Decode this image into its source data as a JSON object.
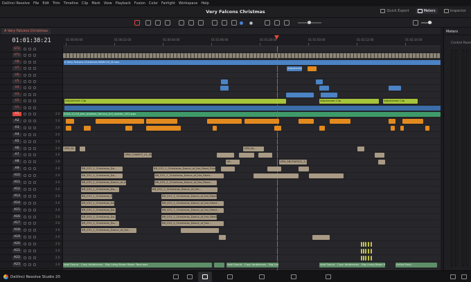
{
  "menu": [
    "DaVinci Resolve",
    "File",
    "Edit",
    "Trim",
    "Timeline",
    "Clip",
    "Mark",
    "View",
    "Playback",
    "Fusion",
    "Color",
    "Fairlight",
    "Workspace",
    "Help"
  ],
  "project_title": "Very Falcons Christmas",
  "top_buttons": {
    "quick_export": "Quick Export",
    "meters": "Meters",
    "inspector": "Inspector"
  },
  "timeline_tab": "A Very Falcons Christmas",
  "timecode": "01:01:38:21",
  "ruler_ticks": [
    "01:00:00:00",
    "01:00:22:00",
    "01:00:44:00",
    "01:01:06:00",
    "01:01:28:00",
    "01:01:50:00",
    "01:02:12:00",
    "01:02:34:00"
  ],
  "right_panel": {
    "title": "Meters",
    "subtitle": "Control Room"
  },
  "tracks": [
    {
      "id": "ST2",
      "kind": "v"
    },
    {
      "id": "ST1",
      "kind": "v"
    },
    {
      "id": "V8",
      "kind": "v"
    },
    {
      "id": "V7",
      "kind": "v"
    },
    {
      "id": "V6",
      "kind": "v"
    },
    {
      "id": "V5",
      "kind": "v"
    },
    {
      "id": "V4",
      "kind": "v"
    },
    {
      "id": "V3",
      "kind": "v"
    },
    {
      "id": "V2",
      "kind": "v"
    },
    {
      "id": "V1",
      "kind": "v"
    },
    {
      "id": "A1",
      "kind": "a",
      "chan": "2.0"
    },
    {
      "id": "A2",
      "kind": "a",
      "chan": "2.0"
    },
    {
      "id": "A3",
      "kind": "a",
      "chan": "2.0"
    },
    {
      "id": "A4",
      "kind": "a",
      "chan": "2.0"
    },
    {
      "id": "A5",
      "kind": "a",
      "chan": "2.0"
    },
    {
      "id": "A6",
      "kind": "a",
      "chan": "2.0"
    },
    {
      "id": "A7",
      "kind": "a",
      "chan": "2.0"
    },
    {
      "id": "A8",
      "kind": "a",
      "chan": "2.0"
    },
    {
      "id": "A9",
      "kind": "a",
      "chan": "2.0"
    },
    {
      "id": "A10",
      "kind": "a",
      "chan": "2.0"
    },
    {
      "id": "A11",
      "kind": "a",
      "chan": "2.0"
    },
    {
      "id": "A12",
      "kind": "a",
      "chan": "2.0"
    },
    {
      "id": "A13",
      "kind": "a",
      "chan": "2.0"
    },
    {
      "id": "A14",
      "kind": "a",
      "chan": "2.0"
    },
    {
      "id": "A15",
      "kind": "a",
      "chan": "2.0"
    },
    {
      "id": "A16",
      "kind": "a",
      "chan": "2.0"
    },
    {
      "id": "A17",
      "kind": "a",
      "chan": "2.0"
    },
    {
      "id": "A18",
      "kind": "a",
      "chan": "2.0"
    },
    {
      "id": "A19",
      "kind": "a",
      "chan": "2.0"
    },
    {
      "id": "A20",
      "kind": "a",
      "chan": "2.0"
    },
    {
      "id": "A21",
      "kind": "a",
      "chan": "2.0"
    },
    {
      "id": "A22",
      "kind": "a",
      "chan": "2.0"
    },
    {
      "id": "A23",
      "kind": "a",
      "chan": "2.0"
    }
  ],
  "clips": {
    "v8_main": "A Very Falcons Christmas MAIN VO_R.mov",
    "adjustment": "Adjustment Clip",
    "v1_lead": "2024-12-04_ben_blakese_falcons_full_master_V01.wav",
    "upm_a": "UPM_BL...",
    "upm_b": "UPM_CHNPOT_01_Machine...",
    "christmas_long": "BR_031_1_Christmas_Dance_of_the_Reed_Flutes_@...",
    "christmas_short": "BR_031_1_Christmas_Da...",
    "christmas_mid": "BR_031_1_Christmas_Dance_of_the...",
    "christmas_dance2": "BR_031_1_Christmas_Dance_of_the_Reed...",
    "tiny": "UP...",
    "upm_c": "UPM_SBCFNFS02_3_Rocki...",
    "sound_a": "Vodi Sound - Cozy Ambiences - Big Living Room Room Tone.wav",
    "sound_b": "Vodi Sound - Cozy Ambiences - Big Living Ro...",
    "sound_c": "Vodi Sound - Cozy Ambiences - Big Living Room Room...",
    "artlist": "Artlist Prod..."
  },
  "brand": "DaVinci Resolve Studio 20"
}
